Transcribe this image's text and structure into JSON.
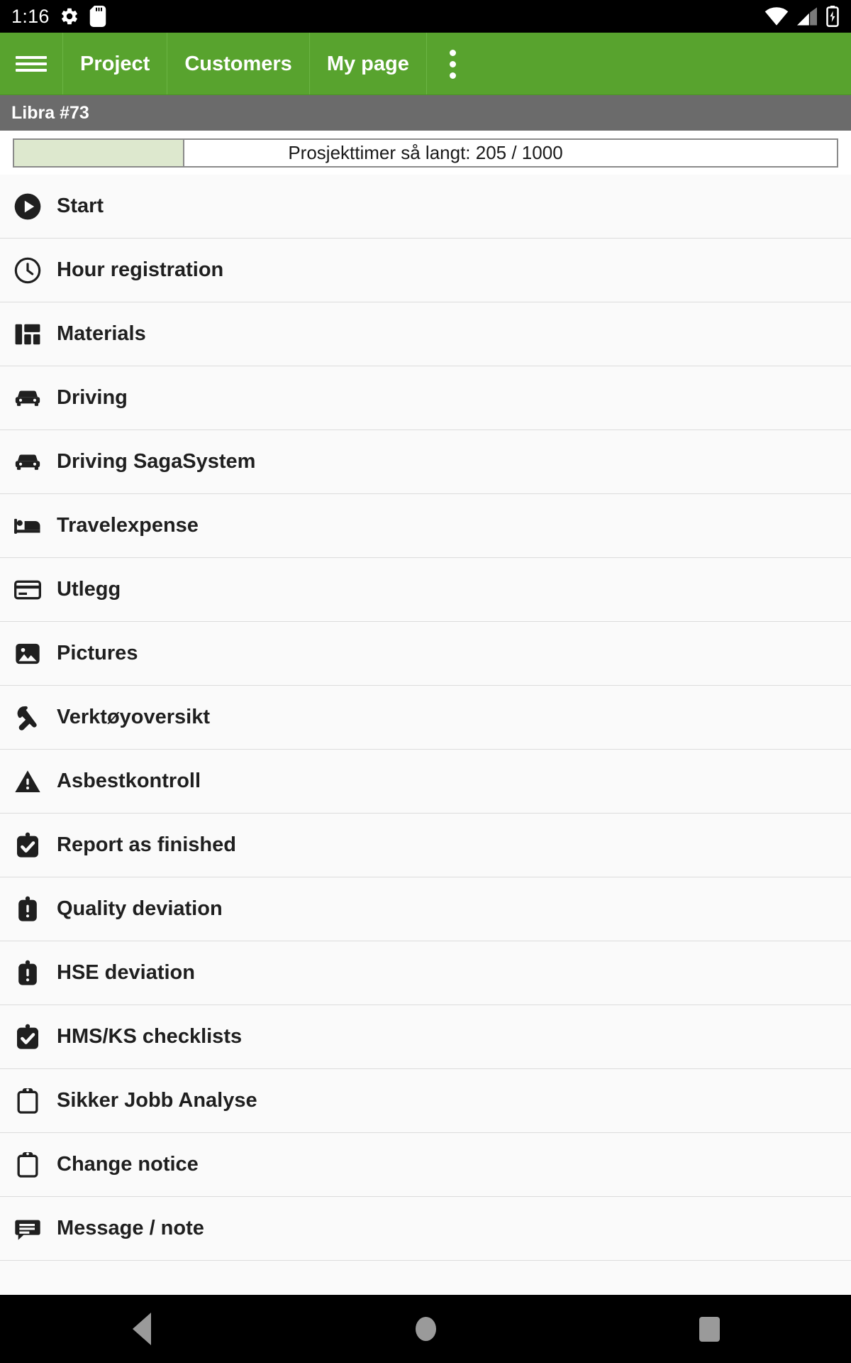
{
  "statusbar": {
    "time": "1:16",
    "icons": [
      "gear-icon",
      "sd-card-icon"
    ],
    "right_icons": [
      "wifi-icon",
      "cellular-signal-icon",
      "battery-charging-icon"
    ]
  },
  "appbar": {
    "menu_icon": "hamburger-menu-icon",
    "tabs": [
      {
        "label": "Project"
      },
      {
        "label": "Customers"
      },
      {
        "label": "My page"
      }
    ],
    "overflow_icon": "overflow-menu-icon",
    "color": "#58a32e"
  },
  "titlebar": {
    "title": "Libra #73",
    "color": "#6b6b6b"
  },
  "progress": {
    "label": "Prosjekttimer så langt: 205 / 1000",
    "current": 205,
    "total": 1000,
    "percent": 20.5,
    "fill_color": "#dde8ce"
  },
  "menu": {
    "items": [
      {
        "label": "Start",
        "icon": "play-circle-icon"
      },
      {
        "label": "Hour registration",
        "icon": "clock-icon"
      },
      {
        "label": "Materials",
        "icon": "dashboard-grid-icon"
      },
      {
        "label": "Driving",
        "icon": "car-icon"
      },
      {
        "label": "Driving SagaSystem",
        "icon": "car-icon"
      },
      {
        "label": "Travelexpense",
        "icon": "bed-icon"
      },
      {
        "label": "Utlegg",
        "icon": "credit-card-icon"
      },
      {
        "label": "Pictures",
        "icon": "image-icon"
      },
      {
        "label": "Verktøyoversikt",
        "icon": "wrench-icon"
      },
      {
        "label": "Asbestkontroll",
        "icon": "warning-triangle-icon"
      },
      {
        "label": "Report as finished",
        "icon": "clipboard-check-filled-icon"
      },
      {
        "label": "Quality deviation",
        "icon": "clipboard-alert-filled-icon"
      },
      {
        "label": "HSE deviation",
        "icon": "clipboard-alert-filled-icon"
      },
      {
        "label": "HMS/KS checklists",
        "icon": "clipboard-check-filled-icon"
      },
      {
        "label": "Sikker Jobb Analyse",
        "icon": "clipboard-outline-icon"
      },
      {
        "label": "Change notice",
        "icon": "clipboard-outline-icon"
      },
      {
        "label": "Message / note",
        "icon": "message-note-icon"
      }
    ]
  },
  "navbottom": {
    "back_label": "Back",
    "home_label": "Home",
    "recents_label": "Recents"
  }
}
